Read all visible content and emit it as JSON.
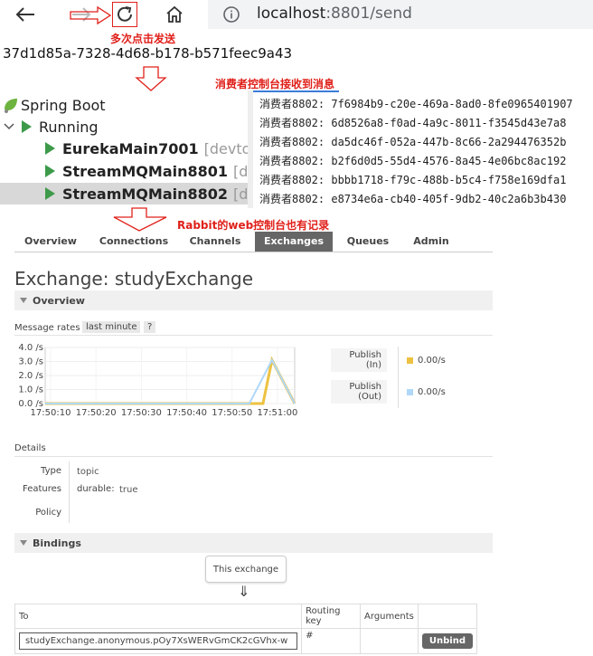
{
  "browser": {
    "url_host": "localhost",
    "url_path": ":8801/send",
    "back_icon": "arrow-left-icon",
    "forward_icon": "arrow-right-icon",
    "reload_icon": "reload-icon",
    "home_icon": "home-icon",
    "info_icon": "info-icon"
  },
  "annotations": {
    "click_send": "多次点击发送",
    "consumer_received": "消费者控制台接收到消息",
    "rabbit_recorded": "Rabbit的web控制台也有记录",
    "color": "#e0201a"
  },
  "response_uuid": "37d1d85a-7328-4d68-b178-b571feec9a43",
  "tree": {
    "root": "Spring Boot",
    "running": "Running",
    "apps": [
      {
        "name": "EurekaMain7001",
        "tag": "[devtools]"
      },
      {
        "name": "StreamMQMain8801",
        "tag": "[devto"
      },
      {
        "name": "StreamMQMain8802",
        "tag": "[devto"
      }
    ]
  },
  "console_lines": [
    "消费者8802: 7f6984b9-c20e-469a-8ad0-8fe0965401907",
    "消费者8802: 6d8526a8-f0ad-4a9c-8011-f3545d43e7a8",
    "消费者8802: da5dc46f-052a-447b-8c66-2a294476352b",
    "消费者8802: b2f6d0d5-55d4-4576-8a45-4e06bc8ac192",
    "消费者8802: bbbb1718-f79c-488b-b5c4-f758e169dfa1",
    "消费者8802: e8734e6a-cb40-405f-9db2-40c2a6b3b430"
  ],
  "tabs": [
    "Overview",
    "Connections",
    "Channels",
    "Exchanges",
    "Queues",
    "Admin"
  ],
  "active_tab": "Exchanges",
  "exchange": {
    "heading_prefix": "Exchange: ",
    "name": "studyExchange",
    "overview_label": "Overview",
    "message_rates_label": "Message rates",
    "last_minute": "last minute",
    "help": "?",
    "publish_in_line1": "Publish",
    "publish_in_line2": "(In)",
    "publish_in_value": "0.00/s",
    "publish_out_line1": "Publish",
    "publish_out_line2": "(Out)",
    "publish_out_value": "0.00/s",
    "details_label": "Details",
    "type_label": "Type",
    "type_value": "topic",
    "features_label": "Features",
    "features_key": "durable:",
    "features_value": "true",
    "policy_label": "Policy",
    "bindings_label": "Bindings",
    "this_exchange": "This exchange",
    "down_arrow": "⇓",
    "table_headers": [
      "To",
      "Routing key",
      "Arguments"
    ],
    "binding_to": "studyExchange.anonymous.pOy7XsWERvGmCK2cGVhx-w",
    "binding_routing_key": "#",
    "unbind_label": "Unbind"
  },
  "chart_data": {
    "type": "line",
    "x": [
      "17:50:10",
      "17:50:20",
      "17:50:30",
      "17:50:40",
      "17:50:50",
      "17:51:00"
    ],
    "y_ticks": [
      "4.0 /s",
      "3.0 /s",
      "2.0 /s",
      "1.0 /s",
      "0.0 /s"
    ],
    "ylim": [
      0,
      4
    ],
    "series": [
      {
        "name": "Publish (In)",
        "color": "#edc240",
        "points": [
          [
            0,
            0.0
          ],
          [
            5,
            0.0
          ],
          [
            45,
            0.0
          ],
          [
            48,
            0.0
          ],
          [
            50,
            3.1
          ],
          [
            55,
            0.0
          ]
        ]
      },
      {
        "name": "Publish (Out)",
        "color": "#afd8f8",
        "points": [
          [
            0,
            0.0
          ],
          [
            45,
            0.0
          ],
          [
            50,
            3.1
          ],
          [
            55,
            0.0
          ]
        ]
      }
    ]
  }
}
